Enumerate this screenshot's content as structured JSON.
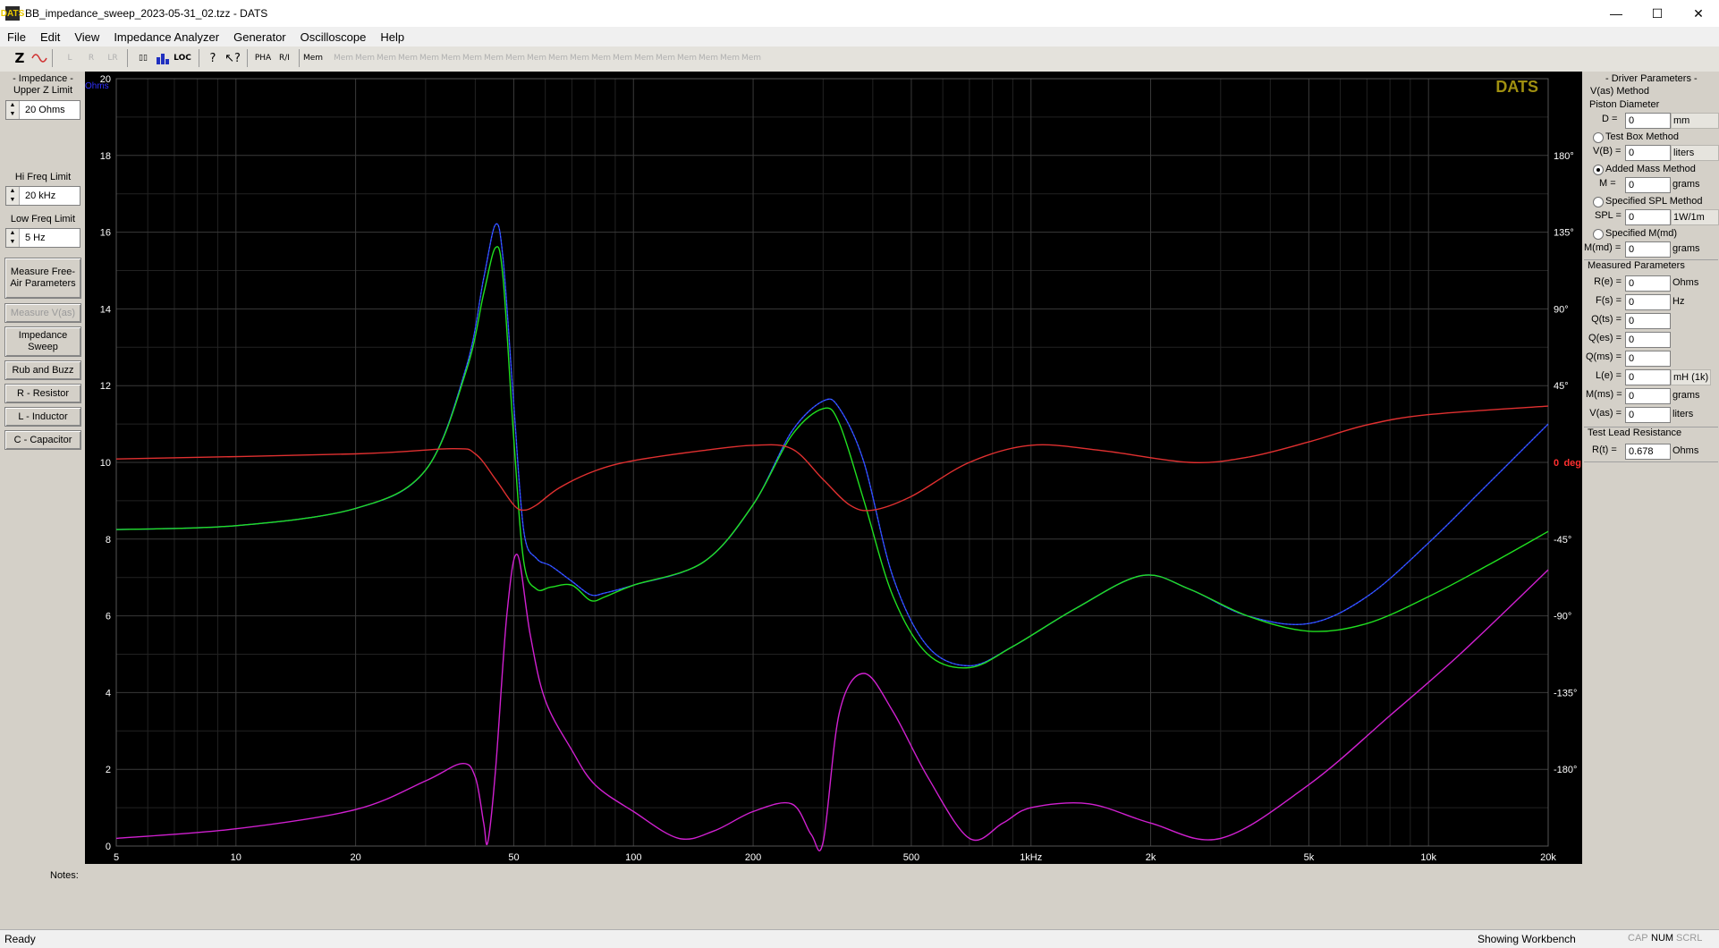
{
  "window": {
    "title": "BB_impedance_sweep_2023-05-31_02.tzz - DATS",
    "app_icon": "DATS"
  },
  "menu": [
    "File",
    "Edit",
    "View",
    "Impedance Analyzer",
    "Generator",
    "Oscilloscope",
    "Help"
  ],
  "toolbar": {
    "impedance": "Z",
    "loc": "LOC",
    "pha": "PHA",
    "mem": "Mem",
    "mem_slots": 20
  },
  "left_panel": {
    "impedance_header": "- Impedance -",
    "upper_z_label": "Upper Z Limit",
    "upper_z_value": "20 Ohms",
    "hi_freq_label": "Hi Freq Limit",
    "hi_freq_value": "20 kHz",
    "low_freq_label": "Low Freq Limit",
    "low_freq_value": "5 Hz",
    "buttons": {
      "free_air": "Measure Free-Air Parameters",
      "vas": "Measure V(as)",
      "sweep": "Impedance Sweep",
      "rub": "Rub and Buzz",
      "resistor": "R - Resistor",
      "inductor": "L - Inductor",
      "capacitor": "C - Capacitor"
    }
  },
  "right_panel": {
    "header": "- Driver Parameters -",
    "vas_method": "V(as) Method",
    "piston_diameter": "Piston Diameter",
    "d_label": "D =",
    "d_value": "0",
    "d_unit": "mm",
    "test_box": "Test Box Method",
    "vb_label": "V(B) =",
    "vb_value": "0",
    "vb_unit": "liters",
    "added_mass": "Added Mass Method",
    "m_label": "M =",
    "m_value": "0",
    "m_unit": "grams",
    "spec_spl": "Specified SPL Method",
    "spl_label": "SPL =",
    "spl_value": "0",
    "spl_unit": "1W/1m",
    "spec_mmd": "Specified M(md)",
    "mmd_label": "M(md) =",
    "mmd_value": "0",
    "mmd_unit": "grams",
    "measured_header": "Measured Parameters",
    "measured": [
      {
        "label": "R(e) =",
        "value": "0",
        "unit": "Ohms"
      },
      {
        "label": "F(s) =",
        "value": "0",
        "unit": "Hz"
      },
      {
        "label": "Q(ts) =",
        "value": "0",
        "unit": ""
      },
      {
        "label": "Q(es) =",
        "value": "0",
        "unit": ""
      },
      {
        "label": "Q(ms) =",
        "value": "0",
        "unit": ""
      },
      {
        "label": "L(e) =",
        "value": "0",
        "unit": "mH (1k)"
      },
      {
        "label": "M(ms) =",
        "value": "0",
        "unit": "grams"
      },
      {
        "label": "V(as) =",
        "value": "0",
        "unit": "liters"
      }
    ],
    "lead_header": "Test Lead Resistance",
    "rt_label": "R(t) =",
    "rt_value": "0.678",
    "rt_unit": "Ohms"
  },
  "notes_label": "Notes:",
  "status": {
    "ready": "Ready",
    "workbench": "Showing Workbench",
    "cap": "CAP",
    "num": "NUM",
    "scrl": "SCRL"
  },
  "chart_data": {
    "type": "line",
    "brand": "DATS",
    "x_scale": "log",
    "xlim": [
      5,
      20000
    ],
    "ylim": [
      0,
      20
    ],
    "y2lim": [
      -225,
      225
    ],
    "ylabel": "Ohms",
    "y2label": "deg",
    "x_ticks": [
      5,
      10,
      20,
      50,
      100,
      200,
      500,
      1000,
      2000,
      5000,
      10000,
      20000
    ],
    "x_tick_labels": [
      "5",
      "10",
      "20",
      "50",
      "100",
      "200",
      "500",
      "1kHz",
      "2k",
      "5k",
      "10k",
      "20k"
    ],
    "y_ticks": [
      0,
      2,
      4,
      6,
      8,
      10,
      12,
      14,
      16,
      18,
      20
    ],
    "y2_ticks": [
      -180,
      -135,
      -90,
      -45,
      0,
      45,
      90,
      135,
      180
    ],
    "y2_tick_labels": [
      "-180°",
      "-135°",
      "-90°",
      "-45°",
      "0",
      "45°",
      "90°",
      "135°",
      "180°"
    ],
    "grid": true,
    "colors": {
      "impedance": "#3030ff",
      "impedance_cyan": "#30d8d8",
      "green": "#20e020",
      "phase": "#e03030",
      "magenta": "#d020d0",
      "brand": "#a09010"
    },
    "series": [
      {
        "axis": "ohms",
        "color": "#3030ff",
        "x": [
          5,
          10,
          20,
          30,
          38,
          42,
          45,
          47,
          50,
          53,
          57,
          62,
          70,
          78,
          85,
          100,
          150,
          200,
          250,
          300,
          330,
          380,
          450,
          550,
          700,
          900,
          1300,
          1900,
          2500,
          3500,
          5000,
          7000,
          10000,
          14000,
          20000
        ],
        "y": [
          8.25,
          8.35,
          8.8,
          9.8,
          12.5,
          14.8,
          16.2,
          15.3,
          11.5,
          8.2,
          7.5,
          7.3,
          6.9,
          6.55,
          6.6,
          6.8,
          7.4,
          8.9,
          10.8,
          11.6,
          11.4,
          10.0,
          7.0,
          5.2,
          4.7,
          5.2,
          6.2,
          7.05,
          6.7,
          6.0,
          5.8,
          6.5,
          7.9,
          9.4,
          11.0
        ]
      },
      {
        "axis": "ohms",
        "color": "#20e020",
        "x": [
          5,
          10,
          20,
          30,
          38,
          42,
          45,
          47,
          50,
          53,
          57,
          62,
          70,
          78,
          85,
          100,
          150,
          200,
          250,
          300,
          330,
          380,
          450,
          550,
          700,
          900,
          1300,
          1900,
          2500,
          3500,
          5000,
          7000,
          10000,
          14000,
          20000
        ],
        "y": [
          8.25,
          8.35,
          8.8,
          9.8,
          12.4,
          14.4,
          15.6,
          14.8,
          10.6,
          7.4,
          6.7,
          6.75,
          6.8,
          6.4,
          6.5,
          6.8,
          7.4,
          8.9,
          10.7,
          11.4,
          11.0,
          9.0,
          6.5,
          5.0,
          4.65,
          5.2,
          6.2,
          7.05,
          6.7,
          6.0,
          5.6,
          5.8,
          6.5,
          7.3,
          8.2
        ]
      },
      {
        "axis": "deg",
        "color": "#e03030",
        "x": [
          5,
          20,
          35,
          40,
          45,
          50,
          53,
          57,
          65,
          80,
          100,
          150,
          200,
          250,
          300,
          350,
          400,
          500,
          700,
          1000,
          1500,
          2500,
          3500,
          5000,
          7000,
          10000,
          20000
        ],
        "y": [
          2,
          5,
          8,
          5,
          -10,
          -25,
          -28,
          -25,
          -15,
          -5,
          1,
          7,
          10,
          8,
          -10,
          -25,
          -28,
          -20,
          0,
          10,
          7,
          0,
          3,
          12,
          22,
          28,
          33
        ]
      },
      {
        "axis": "ohms",
        "color": "#d020d0",
        "x": [
          5,
          10,
          20,
          30,
          37,
          40,
          42,
          43,
          45,
          48,
          51,
          55,
          60,
          70,
          80,
          100,
          130,
          160,
          200,
          250,
          280,
          300,
          330,
          380,
          450,
          550,
          700,
          850,
          1000,
          1400,
          2000,
          3000,
          5000,
          8000,
          12000,
          20000
        ],
        "y": [
          0.2,
          0.45,
          0.95,
          1.7,
          2.15,
          1.8,
          0.6,
          0.1,
          2.0,
          6.0,
          7.6,
          5.5,
          3.8,
          2.5,
          1.6,
          0.9,
          0.2,
          0.4,
          0.9,
          1.1,
          0.3,
          0.1,
          3.5,
          4.5,
          3.5,
          1.8,
          0.2,
          0.6,
          1.0,
          1.1,
          0.6,
          0.2,
          1.6,
          3.4,
          5.0,
          7.2
        ]
      }
    ]
  }
}
